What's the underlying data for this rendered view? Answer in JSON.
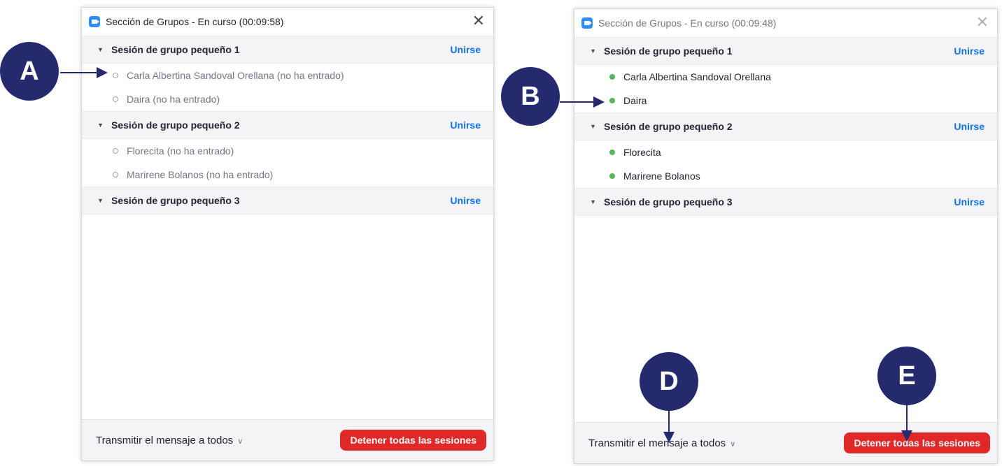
{
  "colors": {
    "accent": "#0e71eb",
    "stop_button": "#e02828",
    "online_dot": "#57b55a",
    "badge": "#252a6f"
  },
  "left": {
    "title": "Sección de Grupos - En curso (00:09:58)",
    "groups": [
      {
        "name": "Sesión de grupo pequeño 1",
        "join": "Unirse",
        "participants": [
          "Carla Albertina Sandoval Orellana (no ha entrado)",
          "Daira (no ha entrado)"
        ]
      },
      {
        "name": "Sesión de grupo pequeño 2",
        "join": "Unirse",
        "participants": [
          "Florecita (no ha entrado)",
          "Marirene Bolanos (no ha entrado)"
        ]
      },
      {
        "name": "Sesión de grupo pequeño 3",
        "join": "Unirse",
        "participants": []
      }
    ],
    "broadcast": "Transmitir el mensaje a todos",
    "stop": "Detener todas las sesiones"
  },
  "right": {
    "title": "Sección de Grupos - En curso (00:09:48)",
    "groups": [
      {
        "name": "Sesión de grupo pequeño 1",
        "join": "Unirse",
        "participants": [
          "Carla Albertina Sandoval Orellana",
          "Daira"
        ]
      },
      {
        "name": "Sesión de grupo pequeño 2",
        "join": "Unirse",
        "participants": [
          "Florecita",
          "Marirene Bolanos"
        ]
      },
      {
        "name": "Sesión de grupo pequeño 3",
        "join": "Unirse",
        "participants": []
      }
    ],
    "broadcast": "Transmitir el mensaje a todos",
    "stop": "Detener todas las sesiones"
  },
  "badges": {
    "a": "A",
    "b": "B",
    "d": "D",
    "e": "E"
  }
}
